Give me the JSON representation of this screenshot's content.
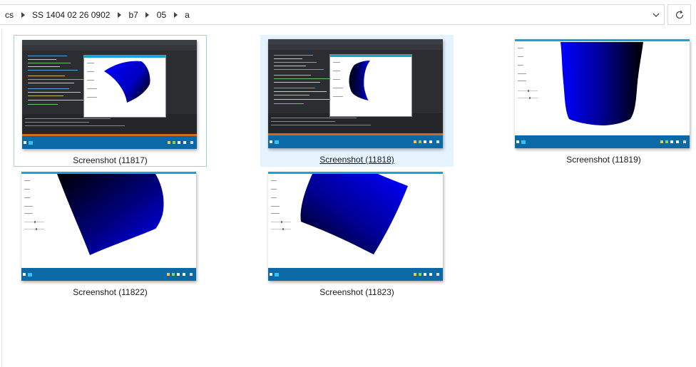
{
  "address_bar": {
    "crumbs": [
      "cs",
      "SS 1404 02 26 0902",
      "b7",
      "05",
      "a"
    ],
    "dropdown_icon": "chevron-down-icon",
    "refresh_icon": "refresh-icon"
  },
  "files": [
    {
      "name": "Screenshot (11817)",
      "state": "focused"
    },
    {
      "name": "Screenshot (11818)",
      "state": "hovered"
    },
    {
      "name": "Screenshot (11819)",
      "state": "normal"
    },
    {
      "name": "Screenshot (11822)",
      "state": "normal"
    },
    {
      "name": "Screenshot (11823)",
      "state": "normal"
    }
  ],
  "colors": {
    "accent_blue": "#0000ff",
    "taskbar": "#0b6aa6",
    "app_titlebar": "#18a3d8",
    "ide_bg": "#2b2d31",
    "ide_orange": "#d16a1b",
    "hover_bg": "#e5f3ff",
    "focus_border": "#99d1ff"
  }
}
